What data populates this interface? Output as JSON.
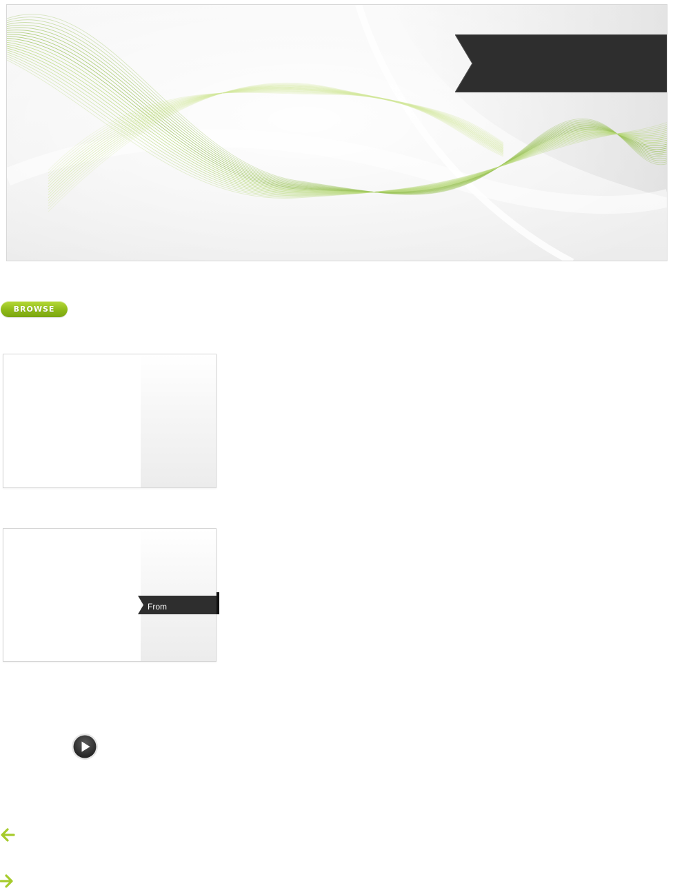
{
  "hero": {
    "ribbon_text": ""
  },
  "browse_button": {
    "label": "BROWSE"
  },
  "cards": [
    {
      "ribbon_label": ""
    },
    {
      "ribbon_label": "From"
    }
  ],
  "colors": {
    "accent_green": "#8fba18",
    "arrow_green": "#a6cb2c",
    "ribbon_dark": "#2e2e2e"
  },
  "icons": {
    "play": "play-icon",
    "prev": "arrow-left-icon",
    "next": "arrow-right-icon"
  }
}
